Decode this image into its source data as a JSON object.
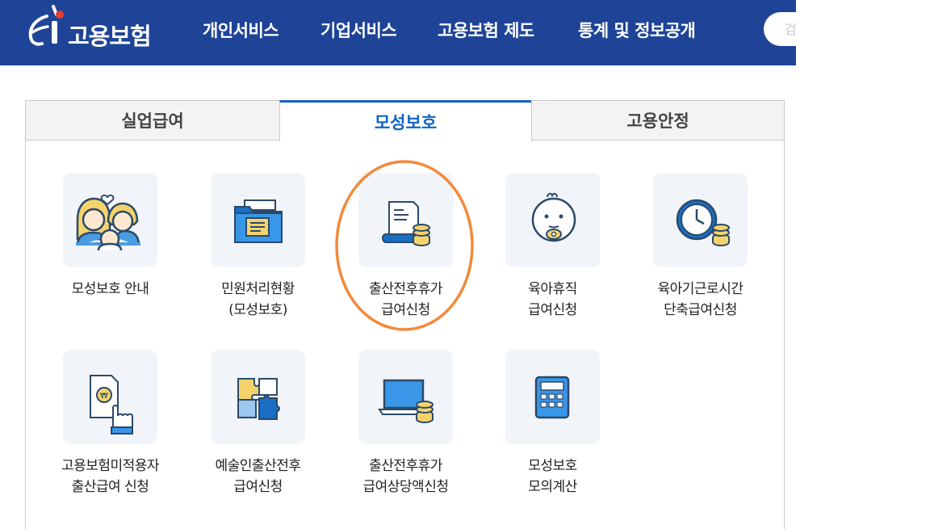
{
  "header": {
    "logo_text": "고용보험",
    "nav": [
      "개인서비스",
      "기업서비스",
      "고용보험 제도",
      "통계 및 정보공개"
    ],
    "search_placeholder": "검",
    "background_color": "#1f4497"
  },
  "tabs": [
    {
      "label": "실업급여",
      "active": false
    },
    {
      "label": "모성보호",
      "active": true
    },
    {
      "label": "고용안정",
      "active": false
    }
  ],
  "accent_color": "#0f63c6",
  "highlight_color": "#f28a3a",
  "tiles": [
    {
      "icon": "family-icon",
      "lines": [
        "모성보호 안내"
      ]
    },
    {
      "icon": "folder-icon",
      "lines": [
        "민원처리현황",
        "(모성보호)"
      ]
    },
    {
      "icon": "document-coins-icon",
      "lines": [
        "출산전후휴가",
        "급여신청"
      ],
      "highlighted": true
    },
    {
      "icon": "baby-icon",
      "lines": [
        "육아휴직",
        "급여신청"
      ]
    },
    {
      "icon": "clock-coins-icon",
      "lines": [
        "육아기근로시간",
        "단축급여신청"
      ]
    },
    {
      "icon": "document-hand-icon",
      "lines": [
        "고용보험미적용자",
        "출산급여 신청"
      ]
    },
    {
      "icon": "puzzle-icon",
      "lines": [
        "예술인출산전후",
        "급여신청"
      ]
    },
    {
      "icon": "laptop-coins-icon",
      "lines": [
        "출산전후휴가",
        "급여상당액신청"
      ]
    },
    {
      "icon": "calculator-icon",
      "lines": [
        "모성보호",
        "모의계산"
      ]
    }
  ]
}
